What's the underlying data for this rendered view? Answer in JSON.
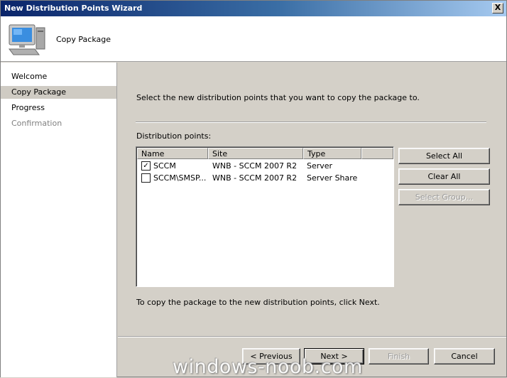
{
  "window": {
    "title": "New Distribution Points Wizard",
    "close_label": "X"
  },
  "header": {
    "step_title": "Copy Package",
    "icon": "computer-icon"
  },
  "nav": {
    "items": [
      {
        "label": "Welcome",
        "state": "normal"
      },
      {
        "label": "Copy Package",
        "state": "active"
      },
      {
        "label": "Progress",
        "state": "normal"
      },
      {
        "label": "Confirmation",
        "state": "disabled"
      }
    ]
  },
  "main": {
    "instruction": "Select the new distribution points that you want to copy the package to.",
    "list_label": "Distribution points:",
    "columns": [
      "Name",
      "Site",
      "Type"
    ],
    "rows": [
      {
        "checked": true,
        "name": "SCCM",
        "site": "WNB - SCCM 2007 R2",
        "type": "Server"
      },
      {
        "checked": false,
        "name": "SCCM\\SMSP...",
        "site": "WNB - SCCM 2007 R2",
        "type": "Server Share"
      }
    ],
    "footer_text": "To copy the package to the new distribution points, click Next."
  },
  "side_buttons": {
    "select_all": "Select All",
    "clear_all": "Clear All",
    "select_group": "Select Group..."
  },
  "footer_buttons": {
    "previous": "< Previous",
    "next": "Next >",
    "finish": "Finish",
    "cancel": "Cancel"
  },
  "watermark": "windows-noob.com"
}
